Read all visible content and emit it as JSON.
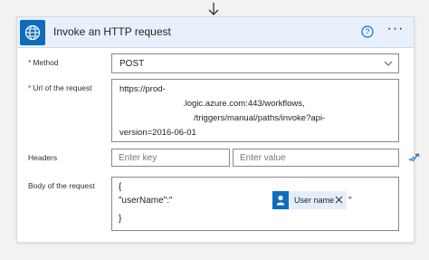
{
  "card": {
    "title": "Invoke an HTTP request",
    "connector_icon": "globe-icon",
    "help_icon": "help-circle-icon",
    "more_label": "···",
    "accent": "#0f6cbd"
  },
  "method": {
    "required_mark": "*",
    "label": "Method",
    "value": "POST"
  },
  "url": {
    "required_mark": "*",
    "label": "Url of the request",
    "lines": [
      "https://prod-",
      ".logic.azure.com:443/workflows,",
      "/triggers/manual/paths/invoke?api-",
      "version=2016-06-01"
    ]
  },
  "headers": {
    "label": "Headers",
    "key_placeholder": "Enter key",
    "value_placeholder": "Enter value",
    "switch_icon": "switch-mode-icon"
  },
  "body": {
    "label": "Body of the request",
    "open_brace": "{",
    "key_text": "\"userName\":\"",
    "token_label": "User name",
    "token_icon": "person-icon",
    "closing_quote": "\"",
    "close_brace": "}"
  }
}
